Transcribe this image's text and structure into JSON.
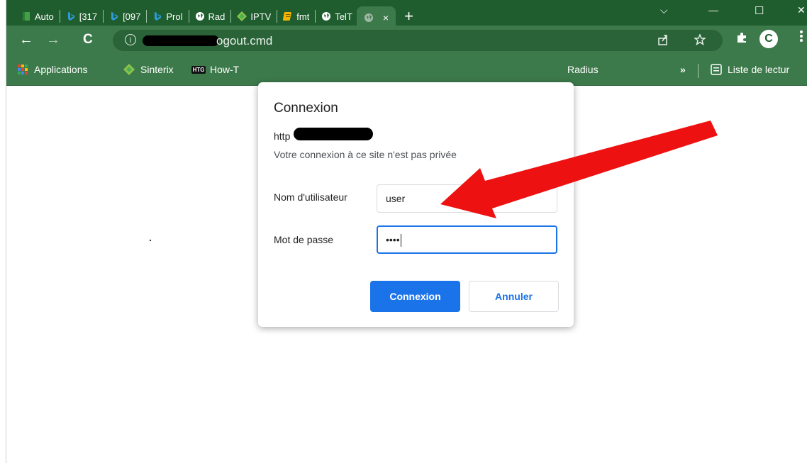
{
  "tabs": [
    {
      "label": "Auto",
      "icon": "green-book-icon",
      "color": "#2e8b3e"
    },
    {
      "label": "[317",
      "icon": "bing-icon",
      "color": "#2d7fd3"
    },
    {
      "label": "[097",
      "icon": "bing-icon",
      "color": "#2d7fd3"
    },
    {
      "label": "Prol",
      "icon": "bing-icon",
      "color": "#2d7fd3"
    },
    {
      "label": "Rad",
      "icon": "globe-icon",
      "color": "#ffffff"
    },
    {
      "label": "IPTV",
      "icon": "sinterix-icon",
      "color": "#8bc34a"
    },
    {
      "label": "fmt",
      "icon": "notebook-icon",
      "color": "#f4b400"
    },
    {
      "label": "TelT",
      "icon": "globe-icon",
      "color": "#ffffff"
    }
  ],
  "active_tab": {
    "label": "",
    "icon": "globe-icon",
    "close": "×"
  },
  "new_tab": "+",
  "window_controls": {
    "dropdown": "⌵",
    "minimize": "—",
    "maximize": "☐",
    "close": "✕"
  },
  "toolbar": {
    "back": "←",
    "forward": "→",
    "reload": "C",
    "info": "i",
    "url_visible": "ogout.cmd",
    "profile_letter": "C"
  },
  "bookmarks": [
    {
      "label": "Applications",
      "icon": "apps-grid-icon"
    },
    {
      "label": "Sinterix",
      "icon": "sinterix-icon"
    },
    {
      "label": "How-T",
      "icon": "htg-icon",
      "badge": "HTG"
    },
    {
      "label": "Radius",
      "icon": "none"
    }
  ],
  "bookmarks_overflow": "»",
  "reading_list": "Liste de lectur",
  "dialog": {
    "title": "Connexion",
    "host_visible": "http",
    "warning": "Votre connexion à ce site n'est pas privée",
    "username_label": "Nom d'utilisateur",
    "username_value": "user",
    "password_label": "Mot de passe",
    "password_value": "••••",
    "submit_label": "Connexion",
    "cancel_label": "Annuler"
  },
  "colors": {
    "titlebar": "#1f5d2e",
    "toolbar": "#3d7a4b",
    "primary_button": "#1a73e8",
    "arrow": "#ee1111"
  }
}
